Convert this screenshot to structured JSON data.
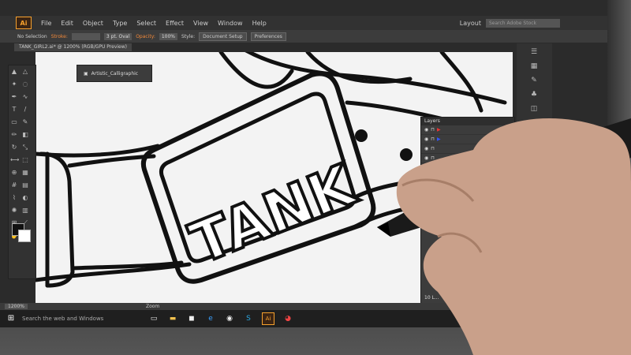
{
  "app": {
    "logo": "Ai"
  },
  "menu": [
    "File",
    "Edit",
    "Object",
    "Type",
    "Select",
    "Effect",
    "View",
    "Window",
    "Help"
  ],
  "workspace": {
    "label": "Layout",
    "search_placeholder": "Search Adobe Stock"
  },
  "control_bar": {
    "selection": "No Selection",
    "stroke_label": "Stroke:",
    "brush": "3 pt. Oval",
    "opacity_label": "Opacity:",
    "opacity_value": "100%",
    "style_label": "Style:",
    "document_setup": "Document Setup",
    "preferences": "Preferences"
  },
  "document": {
    "tab": "TANK_GIRL2.ai* @ 1200% (RGB/GPU Preview)"
  },
  "brush_panel": {
    "name": "Artistic_Calligraphic"
  },
  "artwork": {
    "text": "TANK"
  },
  "layers": {
    "title": "Layers",
    "footer": "10 L..."
  },
  "status": {
    "zoom_value": "1200%",
    "zoom_label": "Zoom"
  },
  "taskbar": {
    "search_text": "Search the web and Windows",
    "ai_icon": "Ai"
  },
  "icons": [
    "windows-icon",
    "task-view-icon",
    "file-explorer-icon",
    "store-icon",
    "edge-icon",
    "media-icon",
    "skype-icon",
    "illustrator-icon",
    "chrome-icon"
  ]
}
